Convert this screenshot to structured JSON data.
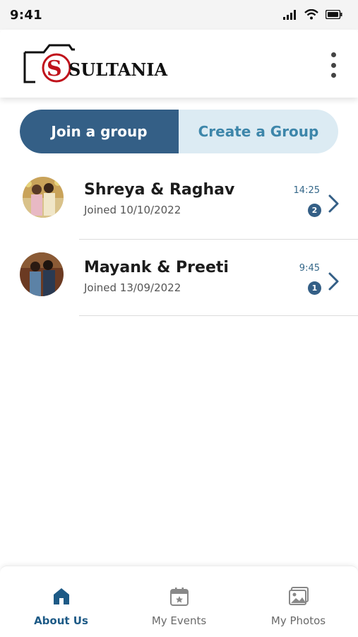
{
  "status_bar": {
    "time": "9:41"
  },
  "header": {
    "logo_text": "SULTANIA",
    "logo_letter": "S"
  },
  "segment": {
    "join_label": "Join a group",
    "create_label": "Create a Group"
  },
  "groups": [
    {
      "name": "Shreya & Raghav",
      "joined": "Joined 10/10/2022",
      "time": "14:25",
      "unread": "2"
    },
    {
      "name": "Mayank & Preeti",
      "joined": "Joined 13/09/2022",
      "time": "9:45",
      "unread": "1"
    }
  ],
  "bottom_nav": [
    {
      "label": "About Us",
      "icon": "home-icon",
      "active": true
    },
    {
      "label": "My Events",
      "icon": "calendar-icon",
      "active": false
    },
    {
      "label": "My Photos",
      "icon": "photos-icon",
      "active": false
    }
  ],
  "colors": {
    "accent": "#345f86",
    "accent_light": "#dcebf3",
    "link": "#3d86aa"
  }
}
